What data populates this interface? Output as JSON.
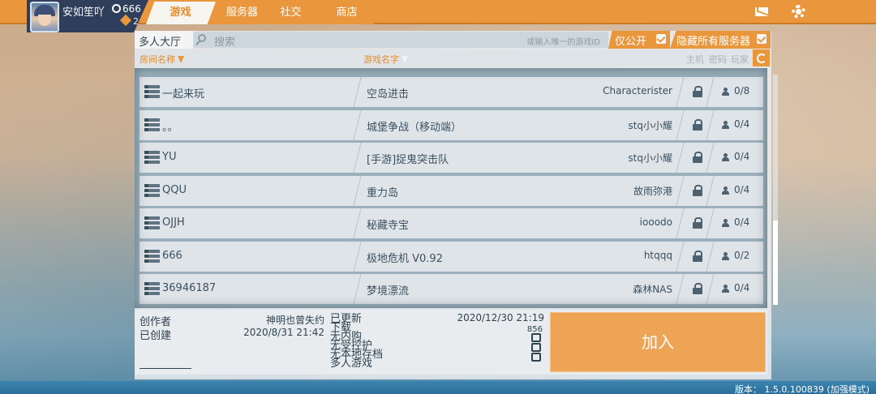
{
  "player": {
    "name": "安如笙吖",
    "coins": "666",
    "level": "2"
  },
  "tabs": [
    {
      "label": "游戏",
      "active": true
    },
    {
      "label": "服务器",
      "active": false
    },
    {
      "label": "社交",
      "active": false
    },
    {
      "label": "商店",
      "active": false
    }
  ],
  "lobby": {
    "title": "多人大厅",
    "search_placeholder": "搜索",
    "search_hint": "或输入唯一的游戏ID",
    "filter_public": "仅公开",
    "filter_hide_all": "隐藏所有服务器"
  },
  "columns": {
    "room": "房间名称",
    "game": "游戏名字",
    "host": "主机",
    "password": "密码",
    "players": "玩家"
  },
  "rooms": [
    {
      "room": "一起来玩",
      "game": "空岛进击",
      "host": "Characterister",
      "players": "0/8"
    },
    {
      "room": "。。",
      "game": "城堡争战（移动端）",
      "host": "stq小小耀",
      "players": "0/4"
    },
    {
      "room": "YU",
      "game": "[手游]捉鬼突击队",
      "host": "stq小小耀",
      "players": "0/4"
    },
    {
      "room": "QQU",
      "game": "重力岛",
      "host": "故雨弥港",
      "players": "0/4"
    },
    {
      "room": "OJJH",
      "game": "秘藏寺宝",
      "host": "iooodo",
      "players": "0/4"
    },
    {
      "room": "666",
      "game": "极地危机 V0.92",
      "host": "htqqq",
      "players": "0/2"
    },
    {
      "room": "36946187",
      "game": "梦境漂流",
      "host": "森林NAS",
      "players": "0/4"
    }
  ],
  "details": {
    "creator_label": "创作者",
    "creator_name": "神明也曾失约",
    "created_label": "已创建",
    "created_date": "2020/8/31 21:42",
    "updated_label": "已更新",
    "updated_date": "2020/12/30 21:19",
    "lines": [
      "下载",
      "无内购",
      "无受控护",
      "无本地存档",
      "多人游戏"
    ],
    "downloads": "856"
  },
  "join_label": "加入",
  "version": "版本： 1.5.0.100839 (加强模式)",
  "colors": {
    "accent": "#e9963d",
    "panel": "#e8ecef"
  }
}
